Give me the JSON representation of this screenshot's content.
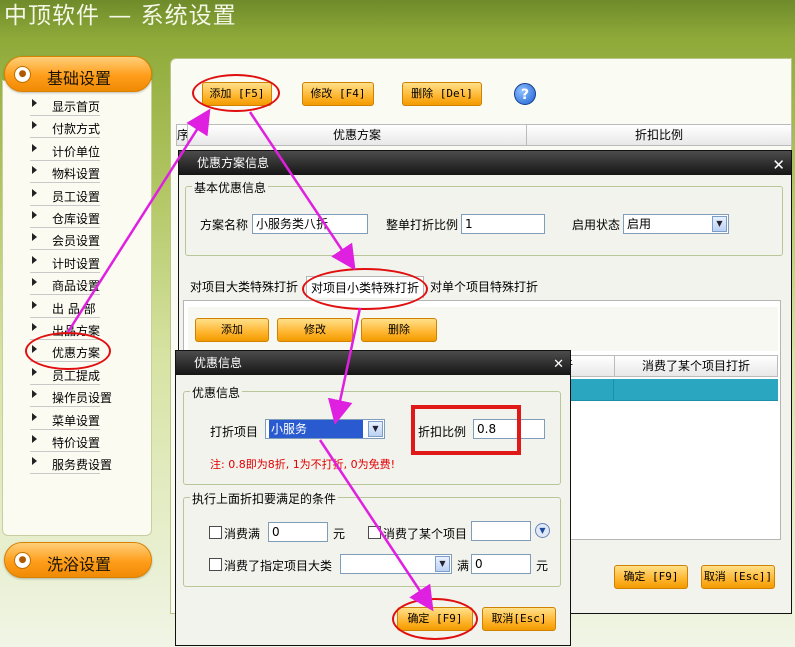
{
  "app_title": "中顶软件 — 系统设置",
  "sidebar": {
    "category_basic": "基础设置",
    "category_bath": "洗浴设置",
    "items": [
      "显示首页",
      "付款方式",
      "计价单位",
      "物料设置",
      "员工设置",
      "仓库设置",
      "会员设置",
      "计时设置",
      "商品设置",
      "出 品 部",
      "出品方案",
      "优惠方案",
      "员工提成",
      "操作员设置",
      "菜单设置",
      "特价设置",
      "服务费设置"
    ]
  },
  "toolbar": {
    "add": "添加 [F5]",
    "edit": "修改 [F4]",
    "delete": "删除 [Del]",
    "help_icon": "?"
  },
  "main_grid": {
    "stub": "序",
    "col1": "优惠方案",
    "col2": "折扣比例"
  },
  "scheme_dialog": {
    "title": "优惠方案信息",
    "basic_group": "基本优惠信息",
    "name_label": "方案名称",
    "name_value": "小服务类八折",
    "ratio_label": "整单打折比例",
    "ratio_value": "1",
    "status_label": "启用状态",
    "status_value": "启用",
    "tabs": [
      "对项目大类特殊打折",
      "对项目小类特殊打折",
      "对单个项目特殊打折"
    ],
    "sub_add": "添加",
    "sub_edit": "修改",
    "sub_delete": "删除",
    "grid_col_partial": "折",
    "grid_col_last": "消费了某个项目打折",
    "ok": "确定 [F9]",
    "cancel": "取消 [Esc]]"
  },
  "discount_dialog": {
    "title": "优惠信息",
    "group1": "优惠信息",
    "item_label": "打折项目",
    "item_value": "小服务",
    "ratio_label": "折扣比例",
    "ratio_value": "0.8",
    "note": "注: 0.8即为8折, 1为不打折, 0为免费!",
    "group2": "执行上面折扣要满足的条件",
    "spend_full": "消费满",
    "spend_value": "0",
    "yuan": "元",
    "spent_item": "消费了某个项目",
    "spent_category": "消费了指定项目大类",
    "full": "满",
    "full_value": "0",
    "yuan2": "元",
    "ok": "确定 [F9]",
    "cancel": "取消[Esc]"
  },
  "colors": {
    "accent_orange": "#ffb52e",
    "annotation_red": "#e01010",
    "annotation_arrow": "#e020e0",
    "selected_row": "#2aa6c0"
  }
}
